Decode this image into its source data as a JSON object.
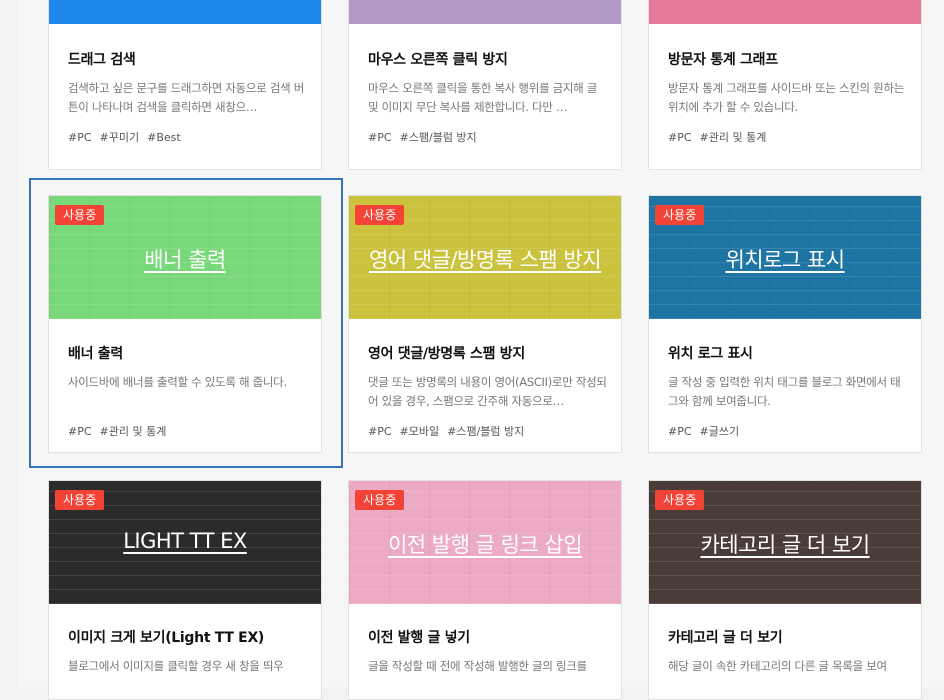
{
  "accent": "#f34336",
  "selection_color": "#3b73b9",
  "cards": [
    {
      "id": "drag-search",
      "color": "#1e88ec",
      "partial": true,
      "title": "드래그 검색",
      "desc": "검색하고 싶은 문구를 드래그하면 자동으로 검색 버튼이 나타나며 검색을 클릭하면 새창으…",
      "tags": [
        "#PC",
        "#꾸미기",
        "#Best"
      ]
    },
    {
      "id": "right-click-block",
      "color": "#b39ac9",
      "partial": true,
      "title": "마우스 오른쪽 클릭 방지",
      "desc": "마우스 오른쪽 클릭을 통한 복사 행위를 금지해 글 및 이미지 무단 복사를 제한합니다. 다만 …",
      "tags": [
        "#PC",
        "#스팸/블럼 방지"
      ]
    },
    {
      "id": "visitor-graph",
      "color": "#e57a9a",
      "partial": true,
      "title": "방문자 통계 그래프",
      "desc": "방문자 통계 그래프를 사이드바 또는 스킨의 원하는 위치에 추가 할 수 있습니다.",
      "tags": [
        "#PC",
        "#관리 및 통계"
      ]
    },
    {
      "id": "banner",
      "color": "#79d87a",
      "partial": false,
      "badge": "사용중",
      "thumb_title": "배너 출력",
      "title": "배너 출력",
      "desc": "사이드바에 배너를 출력할 수 있도록 해 줍니다.",
      "tags": [
        "#PC",
        "#관리 및 통계"
      ]
    },
    {
      "id": "english-spam",
      "color": "#cbc33e",
      "partial": false,
      "badge": "사용중",
      "thumb_title": "영어 댓글/방명록 스팸 방지",
      "title": "영어 댓글/방명록 스팸 방지",
      "desc": "댓글 또는 방명록의 내용이 영어(ASCII)로만 작성되어 있을 경우, 스팸으로 간주해 자동으로…",
      "tags": [
        "#PC",
        "#모바일",
        "#스팸/블럼 방지"
      ]
    },
    {
      "id": "location-log",
      "color": "#1e75a4",
      "partial": false,
      "badge": "사용중",
      "thumb_title": "위치로그 표시",
      "title": "위치 로그 표시",
      "desc": "글 작성 중 입력한 위치 태그를 블로그 화면에서 태그와 함께 보여줍니다.",
      "tags": [
        "#PC",
        "#글쓰기"
      ]
    },
    {
      "id": "light-tt-ex",
      "color": "#2b2b2b",
      "partial": false,
      "badge": "사용중",
      "thumb_title": "LIGHT TT EX",
      "title": "이미지 크게 보기(Light TT EX)",
      "desc": "블로그에서 이미지를 클릭할 경우 새 창을 띄우",
      "tags": []
    },
    {
      "id": "prev-post-link",
      "color": "#ecaac4",
      "partial": false,
      "badge": "사용중",
      "thumb_title": "이전 발행 글 링크 삽입",
      "title": "이전 발행 글 넣기",
      "desc": "글을 작성할 때 전에 작성해 발행한 글의 링크를",
      "tags": []
    },
    {
      "id": "category-more",
      "color": "#4a3c38",
      "partial": false,
      "badge": "사용중",
      "thumb_title": "카테고리 글 더 보기",
      "title": "카테고리 글 더 보기",
      "desc": "해당 글이 속한 카테고리의 다른 글 목록을 보여",
      "tags": []
    }
  ]
}
